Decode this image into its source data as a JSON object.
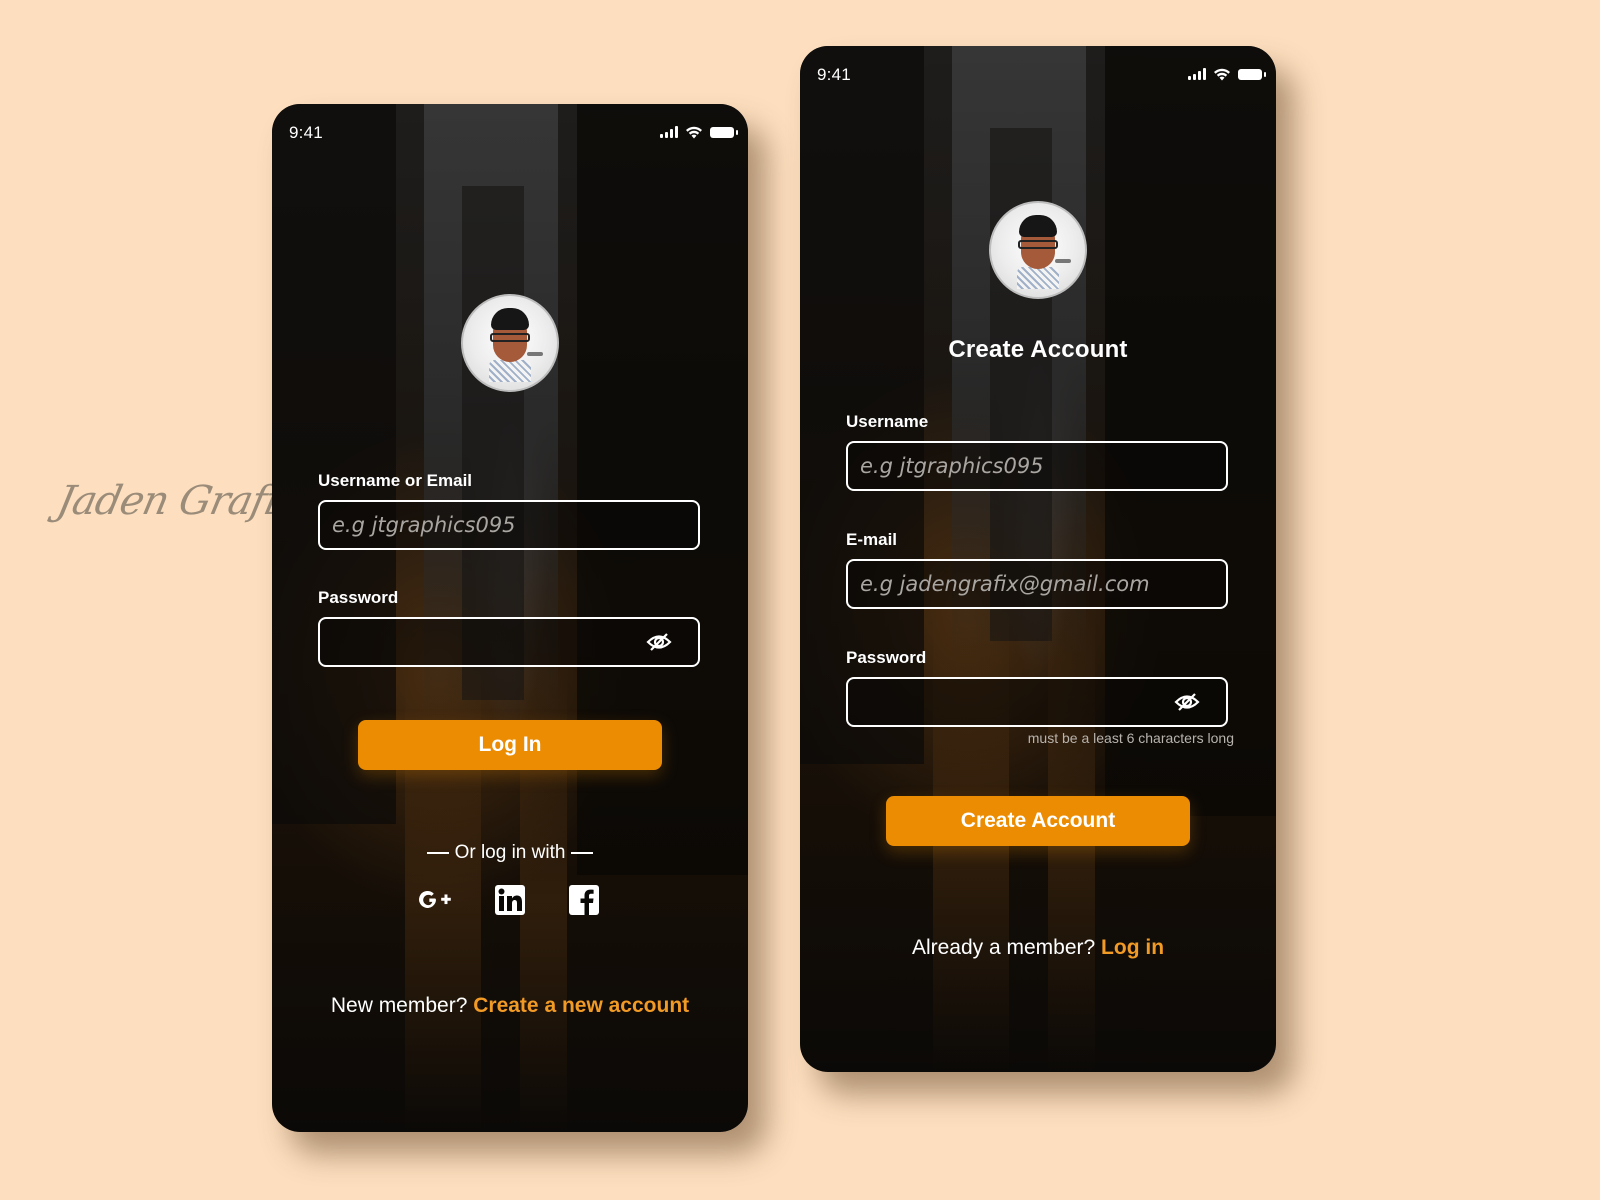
{
  "watermark": {
    "text": "Jaden Grafix"
  },
  "theme": {
    "accent": "#ec8c02",
    "link": "#f19a26",
    "page_bg": "#fddfbf"
  },
  "login_screen": {
    "status_bar": {
      "time": "9:41",
      "icons": [
        "signal-icon",
        "wifi-icon",
        "battery-icon"
      ]
    },
    "avatar": {
      "alt": "profile avatar"
    },
    "username_field": {
      "label": "Username or Email",
      "placeholder": "e.g jtgraphics095",
      "value": ""
    },
    "password_field": {
      "label": "Password",
      "placeholder": "",
      "value": "",
      "toggle_icon": "eye-slash-icon"
    },
    "login_button": {
      "label": "Log In"
    },
    "social_divider": {
      "label": "Or log in with"
    },
    "social_buttons": [
      {
        "name": "google-plus",
        "icon": "google-plus-icon"
      },
      {
        "name": "linkedin",
        "icon": "linkedin-icon"
      },
      {
        "name": "facebook",
        "icon": "facebook-icon"
      }
    ],
    "footer": {
      "prompt": "New member?",
      "link": "Create a new account"
    }
  },
  "signup_screen": {
    "status_bar": {
      "time": "9:41",
      "icons": [
        "signal-icon",
        "wifi-icon",
        "battery-icon"
      ]
    },
    "avatar": {
      "alt": "profile avatar"
    },
    "title": "Create Account",
    "username_field": {
      "label": "Username",
      "placeholder": "e.g jtgraphics095",
      "value": ""
    },
    "email_field": {
      "label": "E-mail",
      "placeholder": "e.g jadengrafix@gmail.com",
      "value": ""
    },
    "password_field": {
      "label": "Password",
      "placeholder": "",
      "value": "",
      "helper": "must be a least 6 characters long",
      "toggle_icon": "eye-slash-icon"
    },
    "create_button": {
      "label": "Create Account"
    },
    "footer": {
      "prompt": "Already a member?",
      "link": "Log in"
    }
  }
}
